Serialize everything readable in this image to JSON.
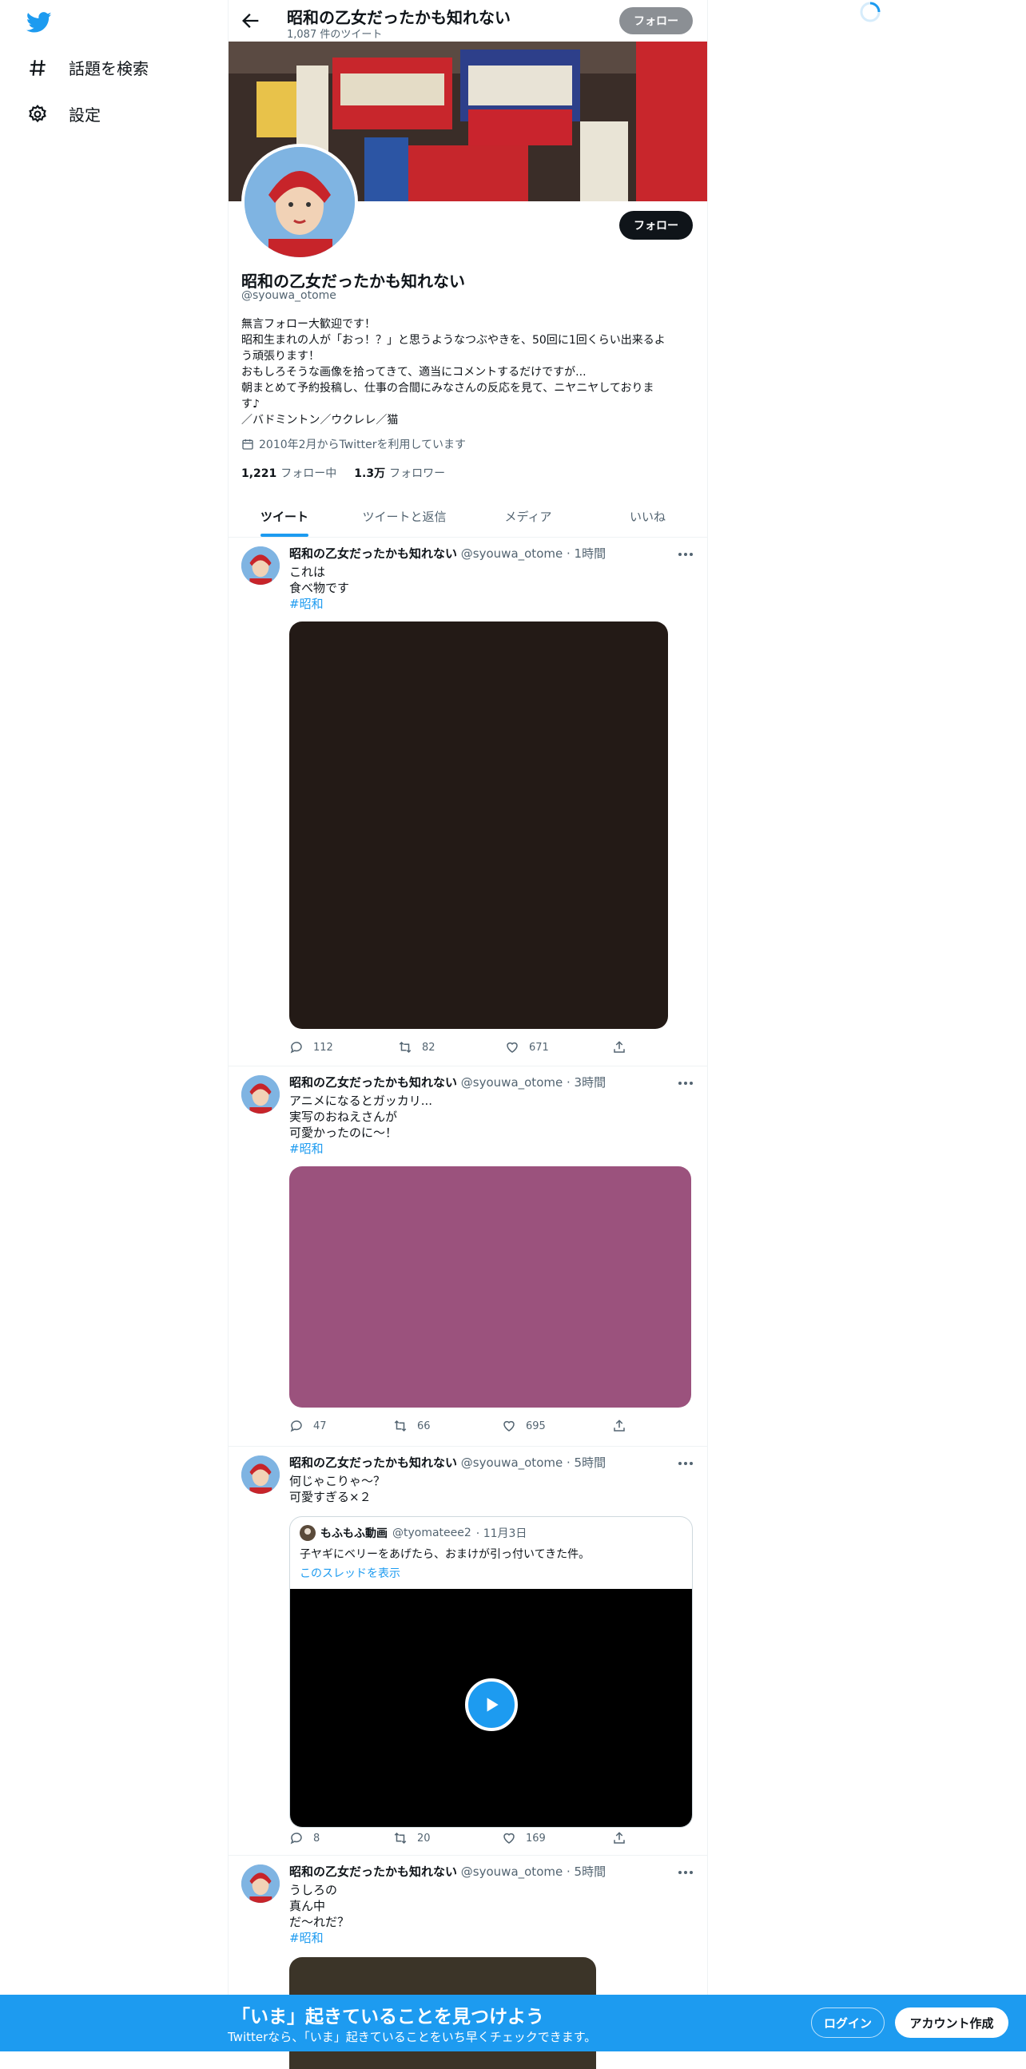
{
  "nav": {
    "logo": "twitter-bird-icon",
    "items": [
      {
        "icon": "hashtag-icon",
        "label": "話題を検索"
      },
      {
        "icon": "gear-icon",
        "label": "設定"
      }
    ]
  },
  "header": {
    "title": "昭和の乙女だったかも知れない",
    "subtitle": "1,087 件のツイート",
    "follow_label": "フォロー"
  },
  "profile": {
    "follow_label": "フォロー",
    "name": "昭和の乙女だったかも知れない",
    "handle": "@syouwa_otome",
    "bio": [
      "無言フォロー大歓迎です！",
      "昭和生まれの人が「おっ！？」と思うようなつぶやきを、50回に1回くらい出来るよ",
      "う頑張ります！",
      "おもしろそうな画像を拾ってきて、適当にコメントするだけですが...",
      "朝まとめて予約投稿し、仕事の合間にみなさんの反応を見て、ニヤニヤしておりま",
      "す♪",
      "／バドミントン／ウクレレ／猫"
    ],
    "joined": "2010年2月からTwitterを利用しています",
    "following_count": "1,221",
    "following_label": "フォロー中",
    "followers_count": "1.3万",
    "followers_label": "フォロワー"
  },
  "tabs": [
    "ツイート",
    "ツイートと返信",
    "メディア",
    "いいね"
  ],
  "tweets": [
    {
      "name": "昭和の乙女だったかも知れない",
      "handle": "@syouwa_otome",
      "time": "· 1時間",
      "lines": [
        "これは",
        "食べ物です"
      ],
      "tag": "#昭和",
      "media_color": "#231a16",
      "replies": "112",
      "retweets": "82",
      "likes": "671"
    },
    {
      "name": "昭和の乙女だったかも知れない",
      "handle": "@syouwa_otome",
      "time": "· 3時間",
      "lines": [
        "アニメになるとガッカリ...",
        "実写のおねえさんが",
        "可愛かったのに～！"
      ],
      "tag": "#昭和",
      "media_color": "#9b527d",
      "replies": "47",
      "retweets": "66",
      "likes": "695"
    },
    {
      "name": "昭和の乙女だったかも知れない",
      "handle": "@syouwa_otome",
      "time": "· 5時間",
      "lines": [
        "何じゃこりゃ～？",
        "可愛すぎる×２"
      ],
      "quote": {
        "name": "もふもふ動画",
        "handle": "@tyomateee2",
        "time": "· 11月3日",
        "text": "子ヤギにベリーをあげたら、おまけが引っ付いてきた件。",
        "thread_link": "このスレッドを表示"
      },
      "replies": "8",
      "retweets": "20",
      "likes": "169"
    },
    {
      "name": "昭和の乙女だったかも知れない",
      "handle": "@syouwa_otome",
      "time": "· 5時間",
      "lines": [
        "うしろの",
        "真ん中",
        "だ～れだ？"
      ],
      "tag": "#昭和",
      "media_color": "#3b3428"
    }
  ],
  "bottom_banner": {
    "title": "「いま」起きていることを見つけよう",
    "subtitle": "Twitterなら、「いま」起きていることをいち早くチェックできます。",
    "login_label": "ログイン",
    "signup_label": "アカウント作成"
  },
  "colors": {
    "accent": "#1d9bf0",
    "text": "#0f1419",
    "muted": "#536471"
  }
}
